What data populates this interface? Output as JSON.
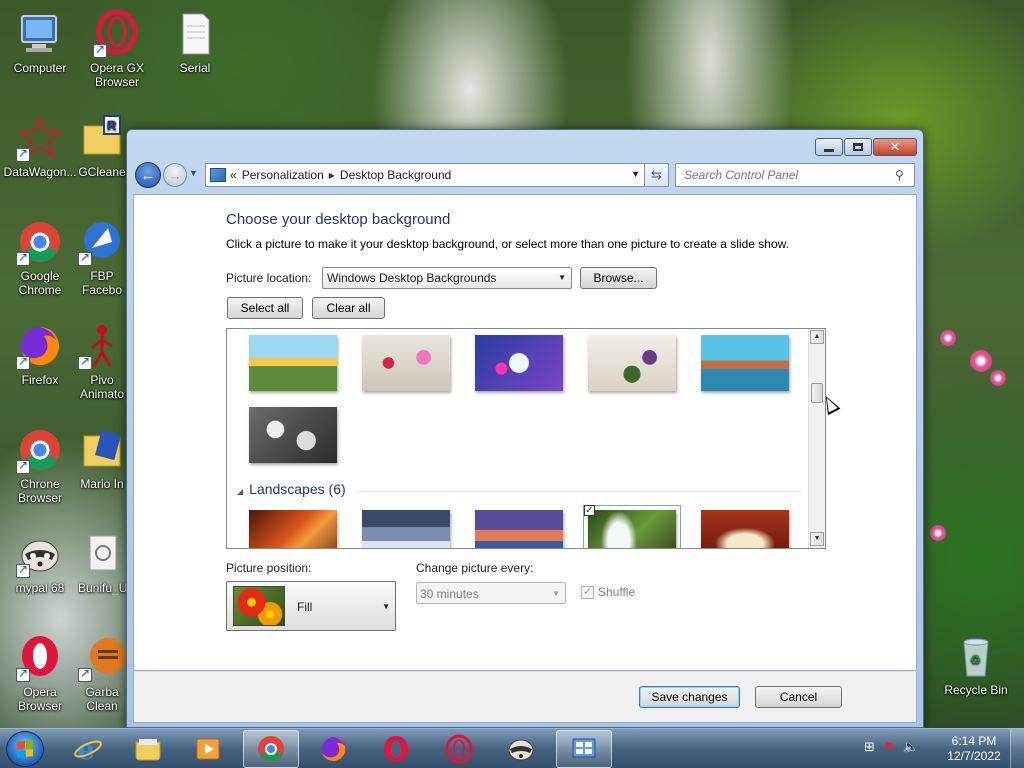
{
  "desktop": {
    "icons": [
      {
        "label": "Computer",
        "label2": ""
      },
      {
        "label": "Opera GX",
        "label2": "Browser"
      },
      {
        "label": "Serial",
        "label2": ""
      },
      {
        "label": "DataWagon...",
        "label2": ""
      },
      {
        "label": "GCleane",
        "label2": ""
      },
      {
        "label": "Google",
        "label2": "Chrome"
      },
      {
        "label": "FBP",
        "label2": "Facebo"
      },
      {
        "label": "Firefox",
        "label2": ""
      },
      {
        "label": "Pivo",
        "label2": "Animato"
      },
      {
        "label": "Chrone",
        "label2": "Browser"
      },
      {
        "label": "Mario In",
        "label2": ""
      },
      {
        "label": "mypal 68",
        "label2": ""
      },
      {
        "label": "Bunifu_U",
        "label2": ""
      },
      {
        "label": "Opera",
        "label2": "Browser"
      },
      {
        "label": "Garba",
        "label2": "Clean"
      },
      {
        "label": "Recycle Bin",
        "label2": ""
      }
    ]
  },
  "window": {
    "address": {
      "prefix": "«",
      "crumbs": [
        "Personalization",
        "Desktop Background"
      ]
    },
    "search_placeholder": "Search Control Panel",
    "title": "Choose your desktop background",
    "description": "Click a picture to make it your desktop background, or select more than one picture to create a slide show.",
    "picture_location_label": "Picture location:",
    "picture_location_value": "Windows Desktop Backgrounds",
    "browse_label": "Browse...",
    "select_all_label": "Select all",
    "clear_all_label": "Clear all",
    "group_landscapes": "Landscapes (6)",
    "picture_position_label": "Picture position:",
    "picture_position_value": "Fill",
    "change_every_label": "Change picture every:",
    "change_every_value": "30 minutes",
    "shuffle_label": "Shuffle",
    "shuffle_checked": true,
    "save_label": "Save changes",
    "cancel_label": "Cancel"
  },
  "taskbar": {
    "time": "6:14 PM",
    "date": "12/7/2022"
  },
  "colors": {
    "heading": "#1e3287",
    "window_frame": "#a9c3e3",
    "close_button": "#c2412a"
  }
}
